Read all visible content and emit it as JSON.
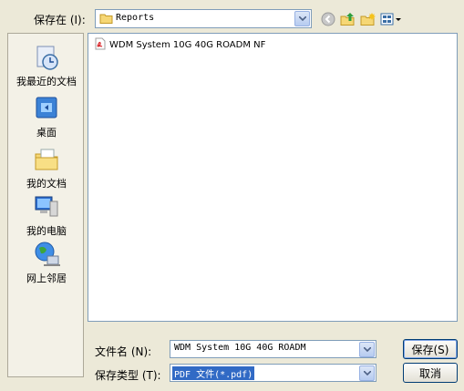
{
  "toolbar": {
    "save_in_label": "保存在 (I):",
    "current_folder": "Reports",
    "icons": [
      "back-icon",
      "up-folder-icon",
      "new-folder-icon",
      "views-menu-icon"
    ]
  },
  "places": [
    {
      "label": "我最近的文档",
      "icon": "recent-documents-icon"
    },
    {
      "label": "桌面",
      "icon": "desktop-icon"
    },
    {
      "label": "我的文档",
      "icon": "my-documents-icon"
    },
    {
      "label": "我的电脑",
      "icon": "my-computer-icon"
    },
    {
      "label": "网上邻居",
      "icon": "network-places-icon"
    }
  ],
  "files": [
    {
      "name": "WDM System 10G 40G ROADM NF",
      "icon": "pdf-file-icon"
    }
  ],
  "form": {
    "filename_label": "文件名 (N):",
    "filename_value": "WDM System 10G 40G ROADM",
    "filetype_label": "保存类型 (T):",
    "filetype_value": "PDF 文件(*.pdf)"
  },
  "buttons": {
    "save": "保存(S)",
    "cancel": "取消"
  }
}
